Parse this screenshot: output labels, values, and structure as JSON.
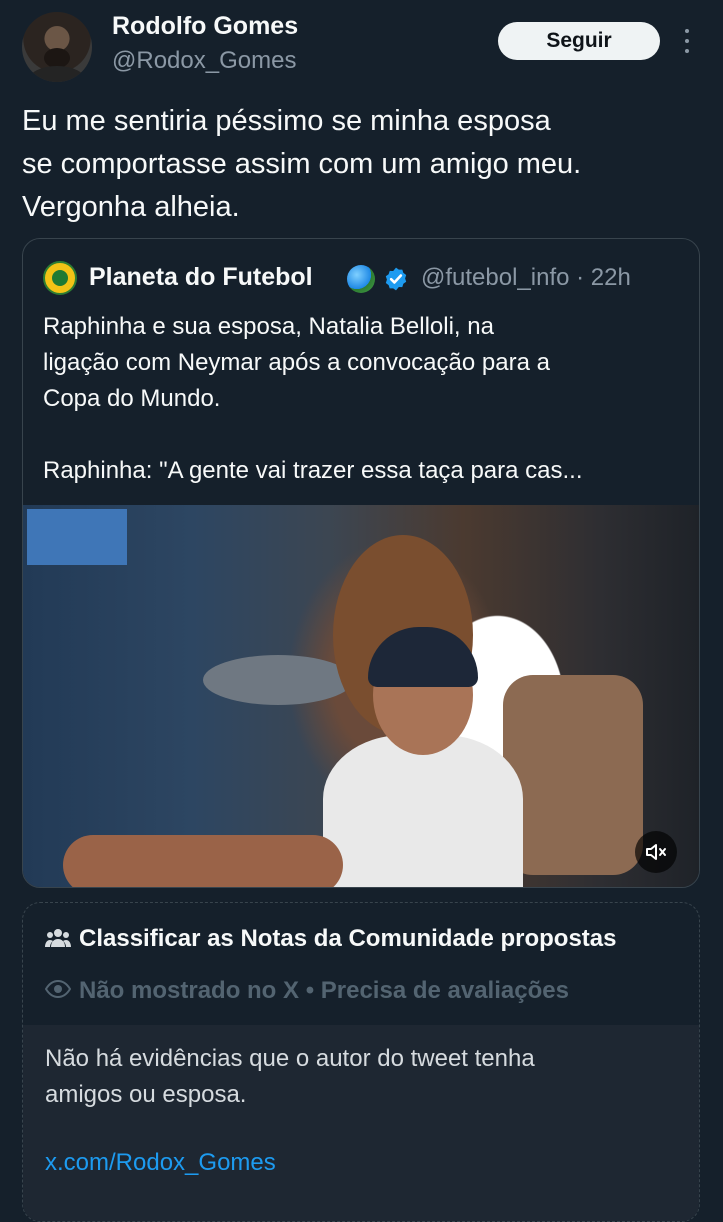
{
  "author": {
    "name": "Rodolfo Gomes",
    "handle": "@Rodox_Gomes",
    "follow_label": "Seguir"
  },
  "tweet": {
    "text": "Eu me sentiria péssimo se minha esposa\nse comportasse assim com um amigo meu.\nVergonha alheia."
  },
  "quoted": {
    "name": "Planeta do Futebol",
    "handle_time": "@futebol_info · 22h",
    "text": "Raphinha e sua esposa, Natalia Belloli, na\nligação com Neymar após a convocação para a\nCopa do Mundo.\n\nRaphinha: \"A gente vai trazer essa taça para cas...",
    "video_muted": true
  },
  "community_note": {
    "title": "Classificar as Notas da Comunidade propostas",
    "status": "Não mostrado no X • Precisa de avaliações",
    "text": "Não há evidências que o autor do tweet tenha\namigos ou esposa.",
    "link": "x.com/Rodox_Gomes"
  },
  "colors": {
    "background": "#15202b",
    "accent": "#1d9bf0",
    "verified": "#1d9bf0"
  }
}
